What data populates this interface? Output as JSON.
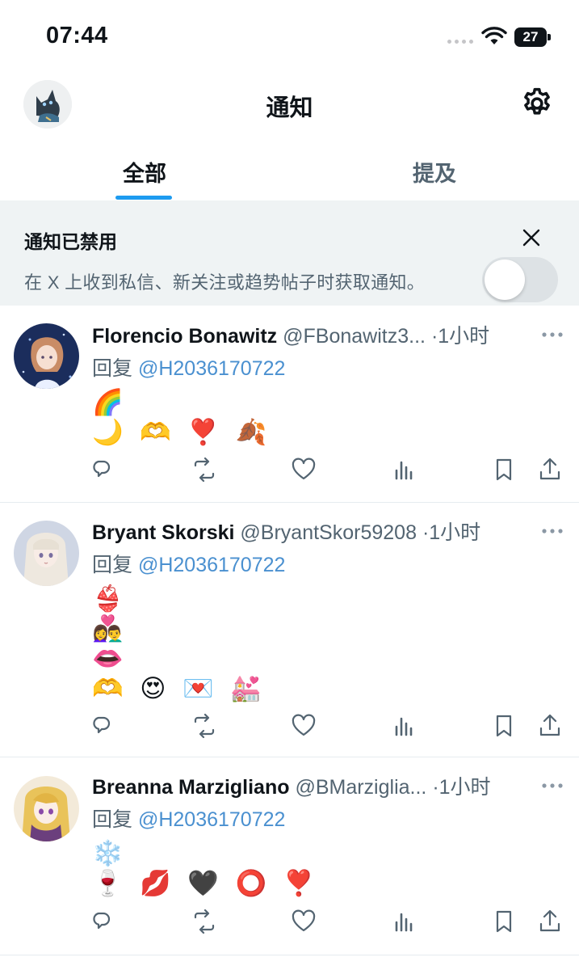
{
  "status": {
    "time": "07:44",
    "battery": "27"
  },
  "header": {
    "title": "通知"
  },
  "tabs": [
    {
      "label": "全部",
      "active": true
    },
    {
      "label": "提及",
      "active": false
    }
  ],
  "banner": {
    "title": "通知已禁用",
    "description": "在 X 上收到私信、新关注或趋势帖子时获取通知。",
    "toggle_on": false
  },
  "posts": [
    {
      "author": "Florencio Bonawitz",
      "handle": "@FBonawitz3...",
      "time": "·1小时",
      "reply_prefix": "回复 ",
      "reply_to": "@H2036170722",
      "emoji_lines": [
        "🌈",
        "🌙 🫶 ❣️ 🍂"
      ]
    },
    {
      "author": "Bryant Skorski",
      "handle": "@BryantSkor59208",
      "time": "·1小时",
      "reply_prefix": "回复 ",
      "reply_to": "@H2036170722",
      "emoji_lines": [
        "👙",
        "👩‍❤️‍👨",
        "👄",
        "🫶 😍 💌 💒"
      ]
    },
    {
      "author": "Breanna Marzigliano",
      "handle": "@BMarziglia...",
      "time": "·1小时",
      "reply_prefix": "回复 ",
      "reply_to": "@H2036170722",
      "emoji_lines": [
        "❄️",
        "🍷 💋 🖤 ⭕ ❣️"
      ]
    }
  ],
  "icons": {
    "reply": "reply-icon",
    "repost": "repost-icon",
    "like": "like-icon",
    "views": "views-icon",
    "bookmark": "bookmark-icon",
    "share": "share-icon"
  },
  "colors": {
    "accent": "#1d9bf0",
    "mention": "#4a90d0",
    "muted": "#536471",
    "banner_bg": "#eff3f4"
  }
}
